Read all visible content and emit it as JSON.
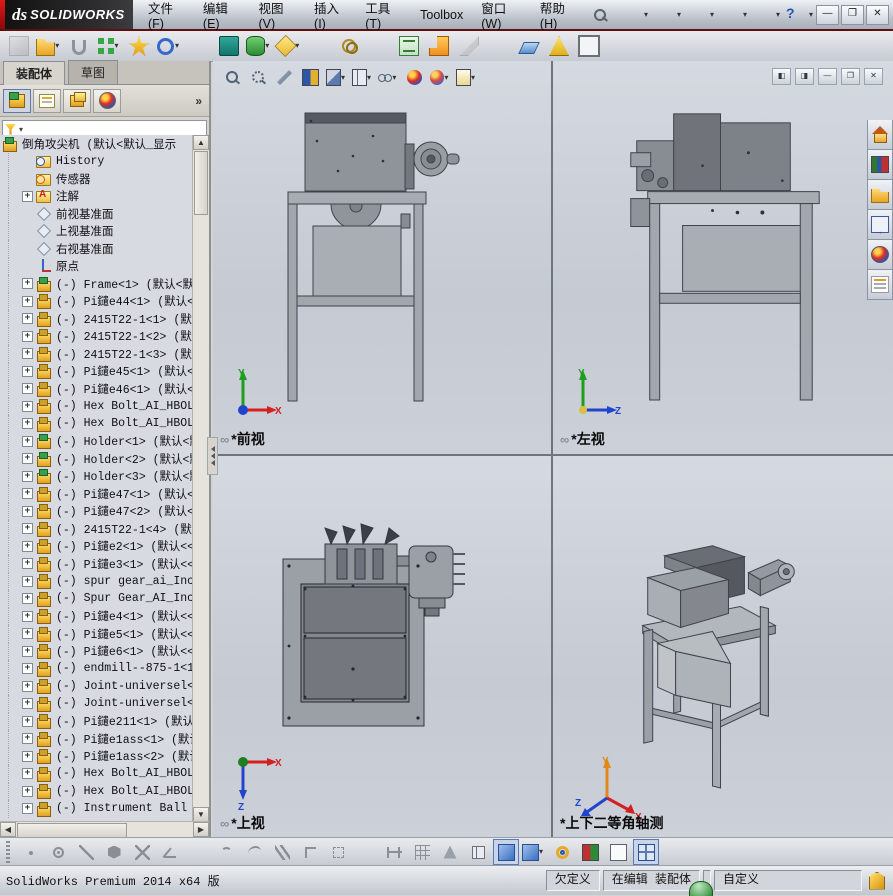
{
  "window": {
    "logo_ds": "ds",
    "logo_text": "SOLIDWORKS",
    "menus": [
      "文件(F)",
      "编辑(E)",
      "视图(V)",
      "插入(I)",
      "工具(T)",
      "Toolbox",
      "窗口(W)",
      "帮助(H)"
    ],
    "caption_min": "—",
    "caption_restore": "❐",
    "caption_close": "✕",
    "quick_icons": [
      {
        "name": "new-document-icon",
        "cls": "q-new",
        "dd": "has-dd"
      },
      {
        "name": "open-document-icon",
        "cls": "q-open",
        "dd": "has-dd"
      },
      {
        "name": "save-icon",
        "cls": "q-save",
        "dd": "has-dd"
      },
      {
        "name": "print-icon",
        "cls": "q-print",
        "dd": "has-dd"
      },
      {
        "name": "undo-icon",
        "cls": "q-undo",
        "dd": "has-dd"
      },
      {
        "name": "help-icon",
        "cls": "q-help",
        "dd": "has-dd"
      }
    ]
  },
  "assembly_toolbar": {
    "items": [
      {
        "name": "insert-component-button",
        "cls": "a-graycube grayed",
        "dd": "no-dd"
      },
      {
        "name": "open-part-button",
        "cls": "a-folder",
        "dd": "has-dd"
      },
      {
        "name": "mate-button",
        "cls": "a-clip",
        "dd": "no-dd"
      },
      {
        "name": "linear-component-pattern-button",
        "cls": "a-pattern",
        "dd": "has-dd"
      },
      {
        "name": "smart-fasteners-button",
        "cls": "a-fastener",
        "dd": "no-dd"
      },
      {
        "name": "move-component-button",
        "cls": "a-ring",
        "dd": "has-dd"
      },
      {
        "name": "separator",
        "cls": "sep",
        "dd": "no-dd"
      },
      {
        "name": "show-hidden-components-button",
        "cls": "a-showhide",
        "dd": "no-dd"
      },
      {
        "name": "assembly-features-button",
        "cls": "a-feature",
        "dd": "has-dd"
      },
      {
        "name": "reference-geometry-button",
        "cls": "a-refgeo",
        "dd": "has-dd"
      },
      {
        "name": "separator",
        "cls": "sep",
        "dd": "no-dd"
      },
      {
        "name": "new-motion-study-button",
        "cls": "a-gears",
        "dd": "no-dd"
      },
      {
        "name": "separator",
        "cls": "sep",
        "dd": "no-dd"
      },
      {
        "name": "bill-of-materials-button",
        "cls": "a-bom",
        "dd": "no-dd"
      },
      {
        "name": "exploded-view-button",
        "cls": "a-explode",
        "dd": "no-dd"
      },
      {
        "name": "explode-line-sketch-button",
        "cls": "a-explline grayed",
        "dd": "no-dd"
      },
      {
        "name": "separator",
        "cls": "sep",
        "dd": "no-dd"
      },
      {
        "name": "instant3d-button",
        "cls": "a-blade",
        "dd": "no-dd"
      },
      {
        "name": "large-assembly-mode-button",
        "cls": "a-warnpic",
        "dd": "no-dd"
      },
      {
        "name": "take-snapshot-button",
        "cls": "a-snapshot",
        "dd": "no-dd"
      }
    ]
  },
  "left_panel": {
    "tabs": [
      {
        "label": "装配体",
        "state": "on"
      },
      {
        "label": "草图",
        "state": "off"
      }
    ],
    "fm_expand": "»",
    "root_label": "倒角攻尖机  (默认<默认_显示",
    "tree": [
      {
        "label": "History",
        "icon": "ic-folder-clock",
        "exp": "no-exp"
      },
      {
        "label": "传感器",
        "icon": "ic-folder-sensor",
        "exp": "no-exp"
      },
      {
        "label": "注解",
        "icon": "ic-folder-note",
        "exp": "has-exp"
      },
      {
        "label": "前视基准面",
        "icon": "ic-plane",
        "exp": "no-exp"
      },
      {
        "label": "上视基准面",
        "icon": "ic-plane",
        "exp": "no-exp"
      },
      {
        "label": "右视基准面",
        "icon": "ic-plane",
        "exp": "no-exp"
      },
      {
        "label": "原点",
        "icon": "ic-origin",
        "exp": "no-exp"
      },
      {
        "label": "(-) Frame<1> (默认<默认",
        "icon": "ic-asm",
        "exp": "has-exp"
      },
      {
        "label": "(-) Pi鑓e44<1> (默认<<默",
        "icon": "ic-part",
        "exp": "has-exp"
      },
      {
        "label": "(-) 2415T22-1<1> (默认<",
        "icon": "ic-part",
        "exp": "has-exp"
      },
      {
        "label": "(-) 2415T22-1<2> (默认<",
        "icon": "ic-part",
        "exp": "has-exp"
      },
      {
        "label": "(-) 2415T22-1<3> (默认<",
        "icon": "ic-part",
        "exp": "has-exp"
      },
      {
        "label": "(-) Pi鑓e45<1> (默认<<默",
        "icon": "ic-part",
        "exp": "has-exp"
      },
      {
        "label": "(-) Pi鑓e46<1> (默认<<默",
        "icon": "ic-part",
        "exp": "has-exp"
      },
      {
        "label": "(-) Hex Bolt_AI_HBOLT 0",
        "icon": "ic-part",
        "exp": "has-exp"
      },
      {
        "label": "(-) Hex Bolt_AI_HBOLT 0",
        "icon": "ic-part",
        "exp": "has-exp"
      },
      {
        "label": "(-) Holder<1> (默认<默认",
        "icon": "ic-asm",
        "exp": "has-exp"
      },
      {
        "label": "(-) Holder<2> (默认<默认",
        "icon": "ic-asm",
        "exp": "has-exp"
      },
      {
        "label": "(-) Holder<3> (默认<默认",
        "icon": "ic-asm",
        "exp": "has-exp"
      },
      {
        "label": "(-) Pi鑓e47<1> (默认<<默",
        "icon": "ic-part",
        "exp": "has-exp"
      },
      {
        "label": "(-) Pi鑓e47<2> (默认<<默",
        "icon": "ic-part",
        "exp": "has-exp"
      },
      {
        "label": "(-) 2415T22-1<4> (默认<",
        "icon": "ic-part",
        "exp": "has-exp"
      },
      {
        "label": "(-) Pi鑓e2<1> (默认<<默",
        "icon": "ic-part",
        "exp": "has-exp"
      },
      {
        "label": "(-) Pi鑓e3<1> (默认<<默",
        "icon": "ic-part",
        "exp": "has-exp"
      },
      {
        "label": "(-) spur gear_ai_Inch -",
        "icon": "ic-part",
        "exp": "has-exp"
      },
      {
        "label": "(-) Spur Gear_AI_Inch -",
        "icon": "ic-part",
        "exp": "has-exp"
      },
      {
        "label": "(-) Pi鑓e4<1> (默认<<默",
        "icon": "ic-part",
        "exp": "has-exp"
      },
      {
        "label": "(-) Pi鑓e5<1> (默认<<默",
        "icon": "ic-part",
        "exp": "has-exp"
      },
      {
        "label": "(-) Pi鑓e6<1> (默认<<默",
        "icon": "ic-part",
        "exp": "has-exp"
      },
      {
        "label": "(-) endmill--875-1<1> (",
        "icon": "ic-part",
        "exp": "has-exp"
      },
      {
        "label": "(-) Joint-universel<1>",
        "icon": "ic-part",
        "exp": "has-exp"
      },
      {
        "label": "(-) Joint-universel<2>",
        "icon": "ic-part",
        "exp": "has-exp"
      },
      {
        "label": "(-) Pi鑓e211<1> (默认<<",
        "icon": "ic-part",
        "exp": "has-exp"
      },
      {
        "label": "(-) Pi鑓e1ass<1> (默认<",
        "icon": "ic-part",
        "exp": "has-exp"
      },
      {
        "label": "(-) Pi鑓e1ass<2> (默认<",
        "icon": "ic-part",
        "exp": "has-exp"
      },
      {
        "label": "(-) Hex Bolt_AI_HBOLT 0",
        "icon": "ic-part",
        "exp": "has-exp"
      },
      {
        "label": "(-) Hex Bolt_AI_HBOLT 0",
        "icon": "ic-part",
        "exp": "has-exp"
      },
      {
        "label": "(-) Instrument Ball Bea",
        "icon": "ic-part",
        "exp": "has-exp"
      }
    ]
  },
  "hud": {
    "items": [
      {
        "name": "zoom-fit-icon",
        "cls": "h-zoom",
        "dd": "no-dd"
      },
      {
        "name": "zoom-to-area-icon",
        "cls": "h-zoomarea",
        "dd": "no-dd"
      },
      {
        "name": "magnified-selection-icon",
        "cls": "h-wand",
        "dd": "no-dd"
      },
      {
        "name": "3d-drawing-views-icon",
        "cls": "h-book",
        "dd": "no-dd"
      },
      {
        "name": "section-view-icon",
        "cls": "h-section",
        "dd": "has-dd"
      },
      {
        "name": "view-orientation-icon",
        "cls": "h-cube",
        "dd": "has-dd"
      },
      {
        "name": "display-style-icon",
        "cls": "h-glasses",
        "dd": "has-dd"
      },
      {
        "name": "appearances-icon",
        "cls": "h-sphere",
        "dd": "no-dd"
      },
      {
        "name": "edit-appearance-icon",
        "cls": "h-sphere2",
        "dd": "has-dd"
      },
      {
        "name": "apply-scene-icon",
        "cls": "h-scene",
        "dd": "has-dd"
      }
    ]
  },
  "viewport_caps": [
    {
      "name": "dock-left-icon",
      "glyph": "◧"
    },
    {
      "name": "dock-right-icon",
      "glyph": "◨"
    },
    {
      "name": "minimize-viewport-icon",
      "glyph": "—"
    },
    {
      "name": "restore-viewport-icon",
      "glyph": "❐"
    },
    {
      "name": "close-viewport-icon",
      "glyph": "✕"
    }
  ],
  "task_pane": {
    "items": [
      {
        "name": "solidworks-resources-tab",
        "cls": "tp-home"
      },
      {
        "name": "design-library-tab",
        "cls": "tp-lib"
      },
      {
        "name": "file-explorer-tab",
        "cls": "tp-folder"
      },
      {
        "name": "view-palette-tab",
        "cls": "tp-palette"
      },
      {
        "name": "appearances-scenes-tab",
        "cls": "tp-sphere"
      },
      {
        "name": "custom-properties-tab",
        "cls": "tp-props"
      }
    ]
  },
  "viewports": [
    {
      "label": "*前视",
      "triad_v": "Y",
      "triad_h": "X"
    },
    {
      "label": "*左视",
      "triad_v": "Y",
      "triad_h": "Z"
    },
    {
      "label": "*上视",
      "triad_h": "X",
      "triad_d": "Z"
    },
    {
      "label": "*上下二等角轴测",
      "triad_v": "Y",
      "triad_se": "X",
      "triad_sw": "Z"
    }
  ],
  "sketch_toolbar": {
    "items": [
      {
        "name": "point-tool-icon",
        "cls": "s-point",
        "press": ""
      },
      {
        "name": "circle-tool-icon",
        "cls": "s-circle",
        "press": ""
      },
      {
        "name": "line-tool-icon",
        "cls": "s-line",
        "press": ""
      },
      {
        "name": "polygon-tool-icon",
        "cls": "s-poly",
        "press": ""
      },
      {
        "name": "trim-entities-icon",
        "cls": "s-trim",
        "press": ""
      },
      {
        "name": "sketch-chamfer-icon",
        "cls": "s-angle",
        "press": ""
      },
      {
        "name": "separator",
        "cls": "sep",
        "press": ""
      },
      {
        "name": "arc-tool-icon",
        "cls": "s-arc",
        "press": ""
      },
      {
        "name": "spline-tool-icon",
        "cls": "s-spline",
        "press": ""
      },
      {
        "name": "parallel-relation-icon",
        "cls": "s-par",
        "press": ""
      },
      {
        "name": "corner-rectangle-icon",
        "cls": "s-rect",
        "press": ""
      },
      {
        "name": "selection-box-icon",
        "cls": "s-dash",
        "press": ""
      },
      {
        "name": "separator",
        "cls": "sep",
        "press": ""
      },
      {
        "name": "smart-dimension-icon",
        "cls": "s-dim",
        "press": ""
      },
      {
        "name": "grid-snap-icon",
        "cls": "s-grid",
        "press": ""
      },
      {
        "name": "mirror-entities-icon",
        "cls": "s-tri",
        "press": ""
      },
      {
        "name": "wireframe-display-icon",
        "cls": "s-wire",
        "press": ""
      },
      {
        "name": "shaded-display-icon",
        "cls": "s-shade",
        "press": "pressed"
      },
      {
        "name": "shaded-with-edges-icon",
        "cls": "s-shade",
        "press": "",
        "dd": "has-dd"
      },
      {
        "name": "curvature-display-icon",
        "cls": "s-torus",
        "press": ""
      },
      {
        "name": "interference-detection-icon",
        "cls": "s-motion",
        "press": ""
      },
      {
        "name": "section-display-icon",
        "cls": "s-white",
        "press": ""
      },
      {
        "name": "viewport-layout-icon",
        "cls": "s-panes",
        "press": "pressed"
      }
    ]
  },
  "statusbar": {
    "app": "SolidWorks Premium 2014 x64 版",
    "underdefined": "欠定义",
    "editing": "在编辑 装配体",
    "custom": "自定义"
  }
}
